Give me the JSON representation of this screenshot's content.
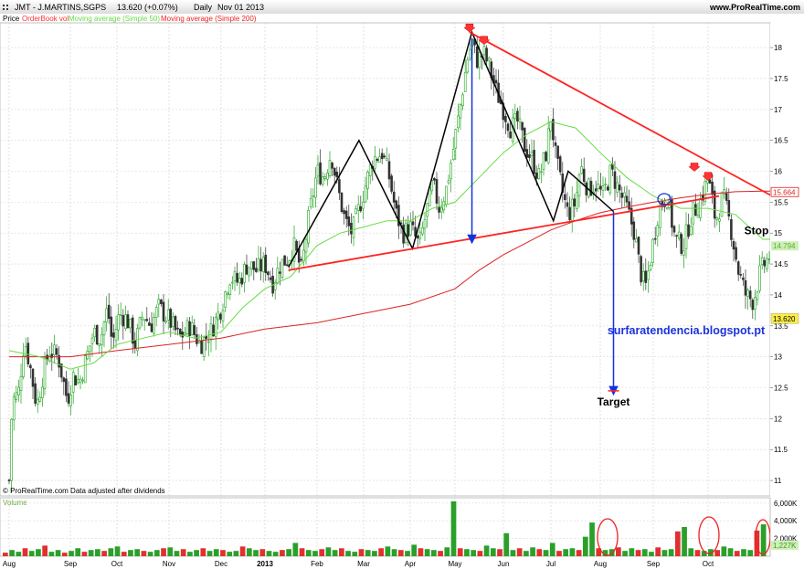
{
  "header": {
    "symbol": "JMT - J.MARTINS,SGPS",
    "quote": "13.620 (+0.07%)",
    "period": "Daily",
    "date": "Nov 01 2013",
    "site": "www.ProRealTime.com"
  },
  "legend": [
    {
      "label": "Price",
      "color": "#000000"
    },
    {
      "label": "OrderBook vol",
      "color": "#ff3333"
    },
    {
      "label": "Moving average (Simple 50)",
      "color": "#66dd44"
    },
    {
      "label": "Moving average (Simple 200)",
      "color": "#ee2222"
    }
  ],
  "footer_note": "© ProRealTime.com  Data adjusted after dividends",
  "volume_label": "Volume",
  "blog": "surfaratendencia.blogspot.pt",
  "colors": {
    "up": "#1fa31f",
    "down": "#333333",
    "ma50": "#66dd44",
    "ma200": "#dd2222",
    "trend": "#ff2222",
    "arrow": "#1133dd",
    "vol_up": "#2aa02a",
    "vol_down": "#e03030"
  },
  "chart_data": {
    "type": "line",
    "x_ticks": [
      "Aug",
      "Sep",
      "Oct",
      "Nov",
      "Dec",
      "2013",
      "Feb",
      "Mar",
      "Apr",
      "May",
      "Jun",
      "Jul",
      "Aug",
      "Sep",
      "Oct"
    ],
    "y_ticks": [
      "18",
      "17.5",
      "17",
      "16.5",
      "16",
      "15.5",
      "15",
      "14.5",
      "14",
      "13.5",
      "13",
      "12.5",
      "12",
      "11.5",
      "11"
    ],
    "ylim": [
      10.75,
      18.4
    ],
    "volume_ticks": [
      "6,000K",
      "4,000K",
      "2,000K"
    ],
    "volume_ylim": [
      0,
      6600
    ],
    "last_price": "13.620",
    "ma200_last": "15.664",
    "ma50_last": "14.794",
    "volume_last": "1,227K",
    "annotations": {
      "target_label": "Target",
      "target_price": 12.45,
      "stop_label": "Stop",
      "stop_price": 14.95
    },
    "price_path": [
      [
        0.0,
        11.0
      ],
      [
        0.05,
        12.3
      ],
      [
        0.15,
        12.4
      ],
      [
        0.25,
        13.3
      ],
      [
        0.35,
        12.8
      ],
      [
        0.45,
        12.2
      ],
      [
        0.55,
        12.7
      ],
      [
        0.65,
        13.1
      ],
      [
        0.8,
        13.0
      ],
      [
        0.95,
        12.3
      ],
      [
        1.05,
        12.7
      ],
      [
        1.2,
        12.6
      ],
      [
        1.35,
        13.0
      ],
      [
        1.5,
        13.4
      ],
      [
        1.65,
        13.3
      ],
      [
        1.8,
        13.8
      ],
      [
        1.9,
        13.2
      ],
      [
        2.05,
        13.7
      ],
      [
        2.2,
        13.6
      ],
      [
        2.35,
        13.2
      ],
      [
        2.5,
        13.7
      ],
      [
        2.65,
        13.5
      ],
      [
        2.8,
        13.8
      ],
      [
        3.0,
        13.6
      ],
      [
        3.2,
        13.3
      ],
      [
        3.4,
        13.5
      ],
      [
        3.6,
        13.2
      ],
      [
        3.8,
        13.4
      ],
      [
        4.0,
        13.8
      ],
      [
        4.2,
        14.3
      ],
      [
        4.4,
        14.2
      ],
      [
        4.6,
        14.5
      ],
      [
        4.8,
        14.4
      ],
      [
        5.0,
        14.5
      ],
      [
        5.15,
        14.2
      ],
      [
        5.3,
        14.5
      ],
      [
        5.45,
        14.6
      ],
      [
        5.55,
        14.8
      ],
      [
        5.7,
        14.4
      ],
      [
        5.85,
        15.3
      ],
      [
        6.0,
        16.0
      ],
      [
        6.15,
        15.9
      ],
      [
        6.3,
        16.3
      ],
      [
        6.45,
        15.7
      ],
      [
        6.6,
        15.2
      ],
      [
        6.75,
        15.0
      ],
      [
        6.9,
        15.4
      ],
      [
        7.05,
        15.8
      ],
      [
        7.2,
        16.2
      ],
      [
        7.4,
        16.3
      ],
      [
        7.55,
        15.9
      ],
      [
        7.7,
        15.3
      ],
      [
        7.85,
        15.0
      ],
      [
        8.0,
        15.1
      ],
      [
        8.2,
        14.8
      ],
      [
        8.35,
        15.3
      ],
      [
        8.5,
        15.8
      ],
      [
        8.65,
        15.4
      ],
      [
        8.8,
        15.7
      ],
      [
        8.95,
        16.3
      ],
      [
        9.1,
        17.0
      ],
      [
        9.25,
        17.8
      ],
      [
        9.35,
        18.1
      ],
      [
        9.45,
        17.8
      ],
      [
        9.6,
        17.9
      ],
      [
        9.7,
        17.7
      ],
      [
        9.85,
        17.3
      ],
      [
        10.0,
        17.0
      ],
      [
        10.15,
        16.7
      ],
      [
        10.3,
        16.8
      ],
      [
        10.45,
        16.4
      ],
      [
        10.6,
        16.2
      ],
      [
        10.75,
        15.9
      ],
      [
        10.9,
        16.3
      ],
      [
        11.0,
        16.9
      ],
      [
        11.1,
        16.2
      ],
      [
        11.25,
        15.6
      ],
      [
        11.35,
        15.3
      ],
      [
        11.5,
        15.5
      ],
      [
        11.6,
        16.1
      ],
      [
        11.75,
        15.7
      ],
      [
        11.9,
        15.8
      ],
      [
        12.05,
        15.6
      ],
      [
        12.2,
        16.0
      ],
      [
        12.35,
        15.7
      ],
      [
        12.5,
        15.4
      ],
      [
        12.65,
        15.0
      ],
      [
        12.75,
        14.4
      ],
      [
        12.85,
        14.1
      ],
      [
        12.95,
        14.6
      ],
      [
        13.1,
        15.4
      ],
      [
        13.25,
        15.6
      ],
      [
        13.4,
        14.9
      ],
      [
        13.55,
        14.8
      ],
      [
        13.7,
        15.3
      ],
      [
        13.85,
        15.5
      ],
      [
        14.0,
        15.9
      ],
      [
        14.15,
        15.2
      ],
      [
        14.3,
        15.6
      ],
      [
        14.45,
        15.1
      ],
      [
        14.6,
        14.4
      ],
      [
        14.75,
        14.0
      ],
      [
        14.9,
        13.9
      ],
      [
        15.05,
        14.4
      ],
      [
        15.2,
        14.6
      ],
      [
        15.35,
        14.9
      ],
      [
        15.5,
        14.7
      ],
      [
        15.6,
        14.4
      ],
      [
        15.75,
        14.3
      ],
      [
        15.85,
        13.9
      ],
      [
        15.95,
        13.62
      ]
    ],
    "ma50_path": [
      [
        0.0,
        13.1
      ],
      [
        0.5,
        13.0
      ],
      [
        1.0,
        12.8
      ],
      [
        1.5,
        12.9
      ],
      [
        2.0,
        13.2
      ],
      [
        2.5,
        13.3
      ],
      [
        3.0,
        13.4
      ],
      [
        3.5,
        13.3
      ],
      [
        4.0,
        13.4
      ],
      [
        4.5,
        13.8
      ],
      [
        5.0,
        14.1
      ],
      [
        5.5,
        14.3
      ],
      [
        6.0,
        14.8
      ],
      [
        6.5,
        15.0
      ],
      [
        7.0,
        15.1
      ],
      [
        7.5,
        15.2
      ],
      [
        8.0,
        15.2
      ],
      [
        8.5,
        15.4
      ],
      [
        9.0,
        15.5
      ],
      [
        9.5,
        15.9
      ],
      [
        10.0,
        16.3
      ],
      [
        10.5,
        16.6
      ],
      [
        11.0,
        16.8
      ],
      [
        11.5,
        16.7
      ],
      [
        12.0,
        16.3
      ],
      [
        12.5,
        15.9
      ],
      [
        13.0,
        15.6
      ],
      [
        13.5,
        15.4
      ],
      [
        14.0,
        15.4
      ],
      [
        14.5,
        15.3
      ],
      [
        15.0,
        14.9
      ],
      [
        15.5,
        14.9
      ],
      [
        15.95,
        14.8
      ]
    ],
    "ma200_path": [
      [
        0.0,
        13.0
      ],
      [
        1.0,
        13.0
      ],
      [
        2.0,
        13.1
      ],
      [
        3.0,
        13.2
      ],
      [
        4.0,
        13.3
      ],
      [
        5.0,
        13.45
      ],
      [
        6.0,
        13.55
      ],
      [
        7.0,
        13.7
      ],
      [
        8.0,
        13.85
      ],
      [
        9.0,
        14.1
      ],
      [
        9.5,
        14.4
      ],
      [
        10.0,
        14.65
      ],
      [
        10.5,
        14.85
      ],
      [
        11.0,
        15.05
      ],
      [
        11.5,
        15.2
      ],
      [
        12.0,
        15.33
      ],
      [
        12.5,
        15.42
      ],
      [
        13.0,
        15.5
      ],
      [
        13.5,
        15.57
      ],
      [
        14.0,
        15.63
      ],
      [
        14.5,
        15.67
      ],
      [
        15.0,
        15.68
      ],
      [
        15.5,
        15.68
      ],
      [
        15.95,
        15.66
      ]
    ],
    "pattern_zigzag": [
      [
        5.45,
        14.45
      ],
      [
        6.9,
        16.5
      ],
      [
        8.05,
        14.75
      ],
      [
        9.35,
        18.25
      ],
      [
        11.05,
        15.2
      ],
      [
        11.35,
        16.0
      ],
      [
        12.25,
        15.35
      ]
    ],
    "neckline": [
      [
        5.45,
        14.4
      ],
      [
        14.2,
        15.6
      ]
    ],
    "upper_trend": [
      [
        9.3,
        18.25
      ],
      [
        16.0,
        15.2
      ]
    ],
    "arrow_measure": {
      "x": 9.35,
      "from": 18.15,
      "to": 14.9
    },
    "arrow_target": {
      "x": 12.25,
      "from": 15.35,
      "to": 12.45
    },
    "red_markers": [
      [
        9.3,
        18.25
      ],
      [
        9.6,
        18.05
      ],
      [
        13.75,
        16.0
      ],
      [
        14.0,
        15.85
      ]
    ],
    "circle_marker": [
      13.2,
      15.55
    ],
    "volume_series": [
      400,
      700,
      500,
      900,
      600,
      800,
      1200,
      500,
      700,
      400,
      600,
      900,
      500,
      700,
      800,
      600,
      900,
      1100,
      500,
      700,
      800,
      600,
      500,
      700,
      900,
      1000,
      600,
      800,
      500,
      700,
      900,
      600,
      800,
      700,
      500,
      600,
      1100,
      900,
      700,
      800,
      600,
      500,
      700,
      800,
      1500,
      900,
      700,
      600,
      800,
      1000,
      700,
      900,
      600,
      500,
      800,
      700,
      600,
      900,
      1100,
      800,
      700,
      600,
      1300,
      900,
      800,
      700,
      600,
      1000,
      6200,
      900,
      800,
      700,
      600,
      1200,
      900,
      800,
      2600,
      700,
      900,
      600,
      1000,
      800,
      700,
      1500,
      600,
      800,
      900,
      700,
      2200,
      3800,
      900,
      700,
      800,
      1000,
      600,
      900,
      700,
      800,
      500,
      1000,
      700,
      800,
      2800,
      3300,
      900,
      700,
      600,
      800,
      700,
      1100,
      900,
      600,
      800,
      700,
      2900,
      3600
    ]
  }
}
